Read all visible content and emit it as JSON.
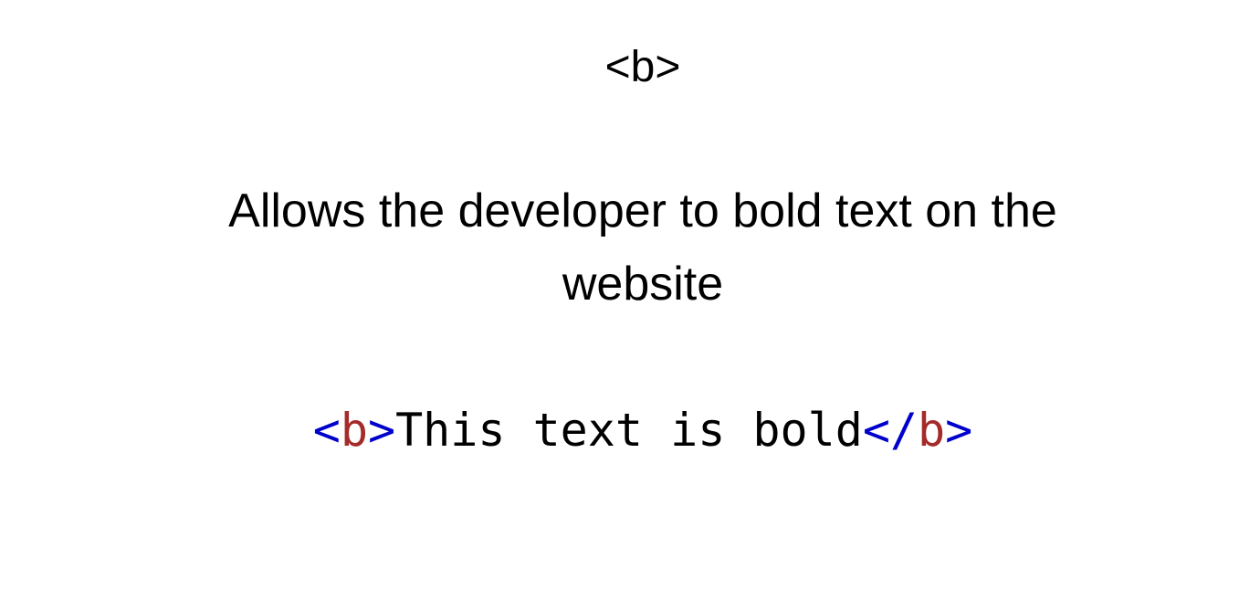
{
  "heading": {
    "tag": "<b>"
  },
  "description": {
    "text": "Allows the developer to bold text on the website"
  },
  "example": {
    "open_bracket": "<",
    "open_tag_name": "b",
    "open_close_bracket": ">",
    "content": "This text is bold",
    "close_open_bracket": "</",
    "close_tag_name": "b",
    "close_close_bracket": ">"
  },
  "colors": {
    "bracket": "#0000cd",
    "tag_name": "#a52a2a",
    "text": "#000000",
    "background": "#ffffff"
  }
}
